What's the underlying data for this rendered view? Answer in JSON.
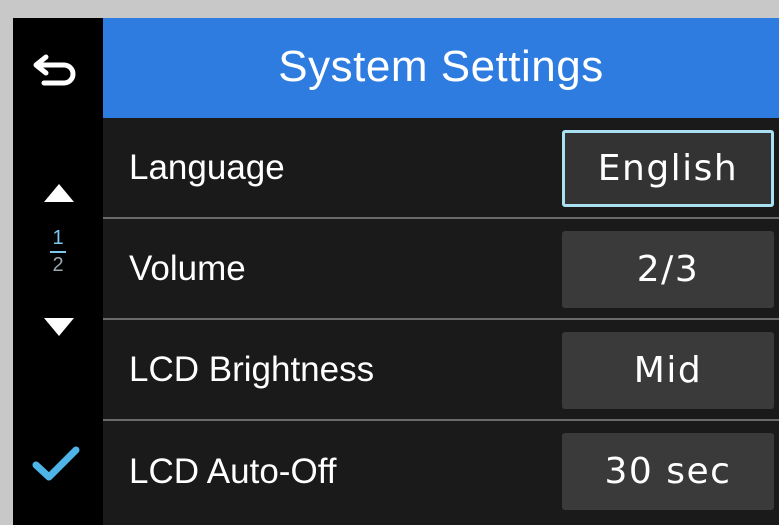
{
  "header": {
    "title": "System Settings"
  },
  "pager": {
    "current": "1",
    "total": "2"
  },
  "icons": {
    "back": "back-arrow-icon",
    "up": "triangle-up-icon",
    "down": "triangle-down-icon",
    "confirm": "checkmark-icon"
  },
  "colors": {
    "header_bg": "#2e7ce0",
    "accent": "#7ec8ef",
    "selected_border": "#a9e1f3",
    "value_bg": "#3a3a3a"
  },
  "settings": [
    {
      "label": "Language",
      "value": "English",
      "selected": true
    },
    {
      "label": "Volume",
      "value": "2/3",
      "selected": false
    },
    {
      "label": "LCD Brightness",
      "value": "Mid",
      "selected": false
    },
    {
      "label": "LCD Auto-Off",
      "value": "30 sec",
      "selected": false
    }
  ]
}
